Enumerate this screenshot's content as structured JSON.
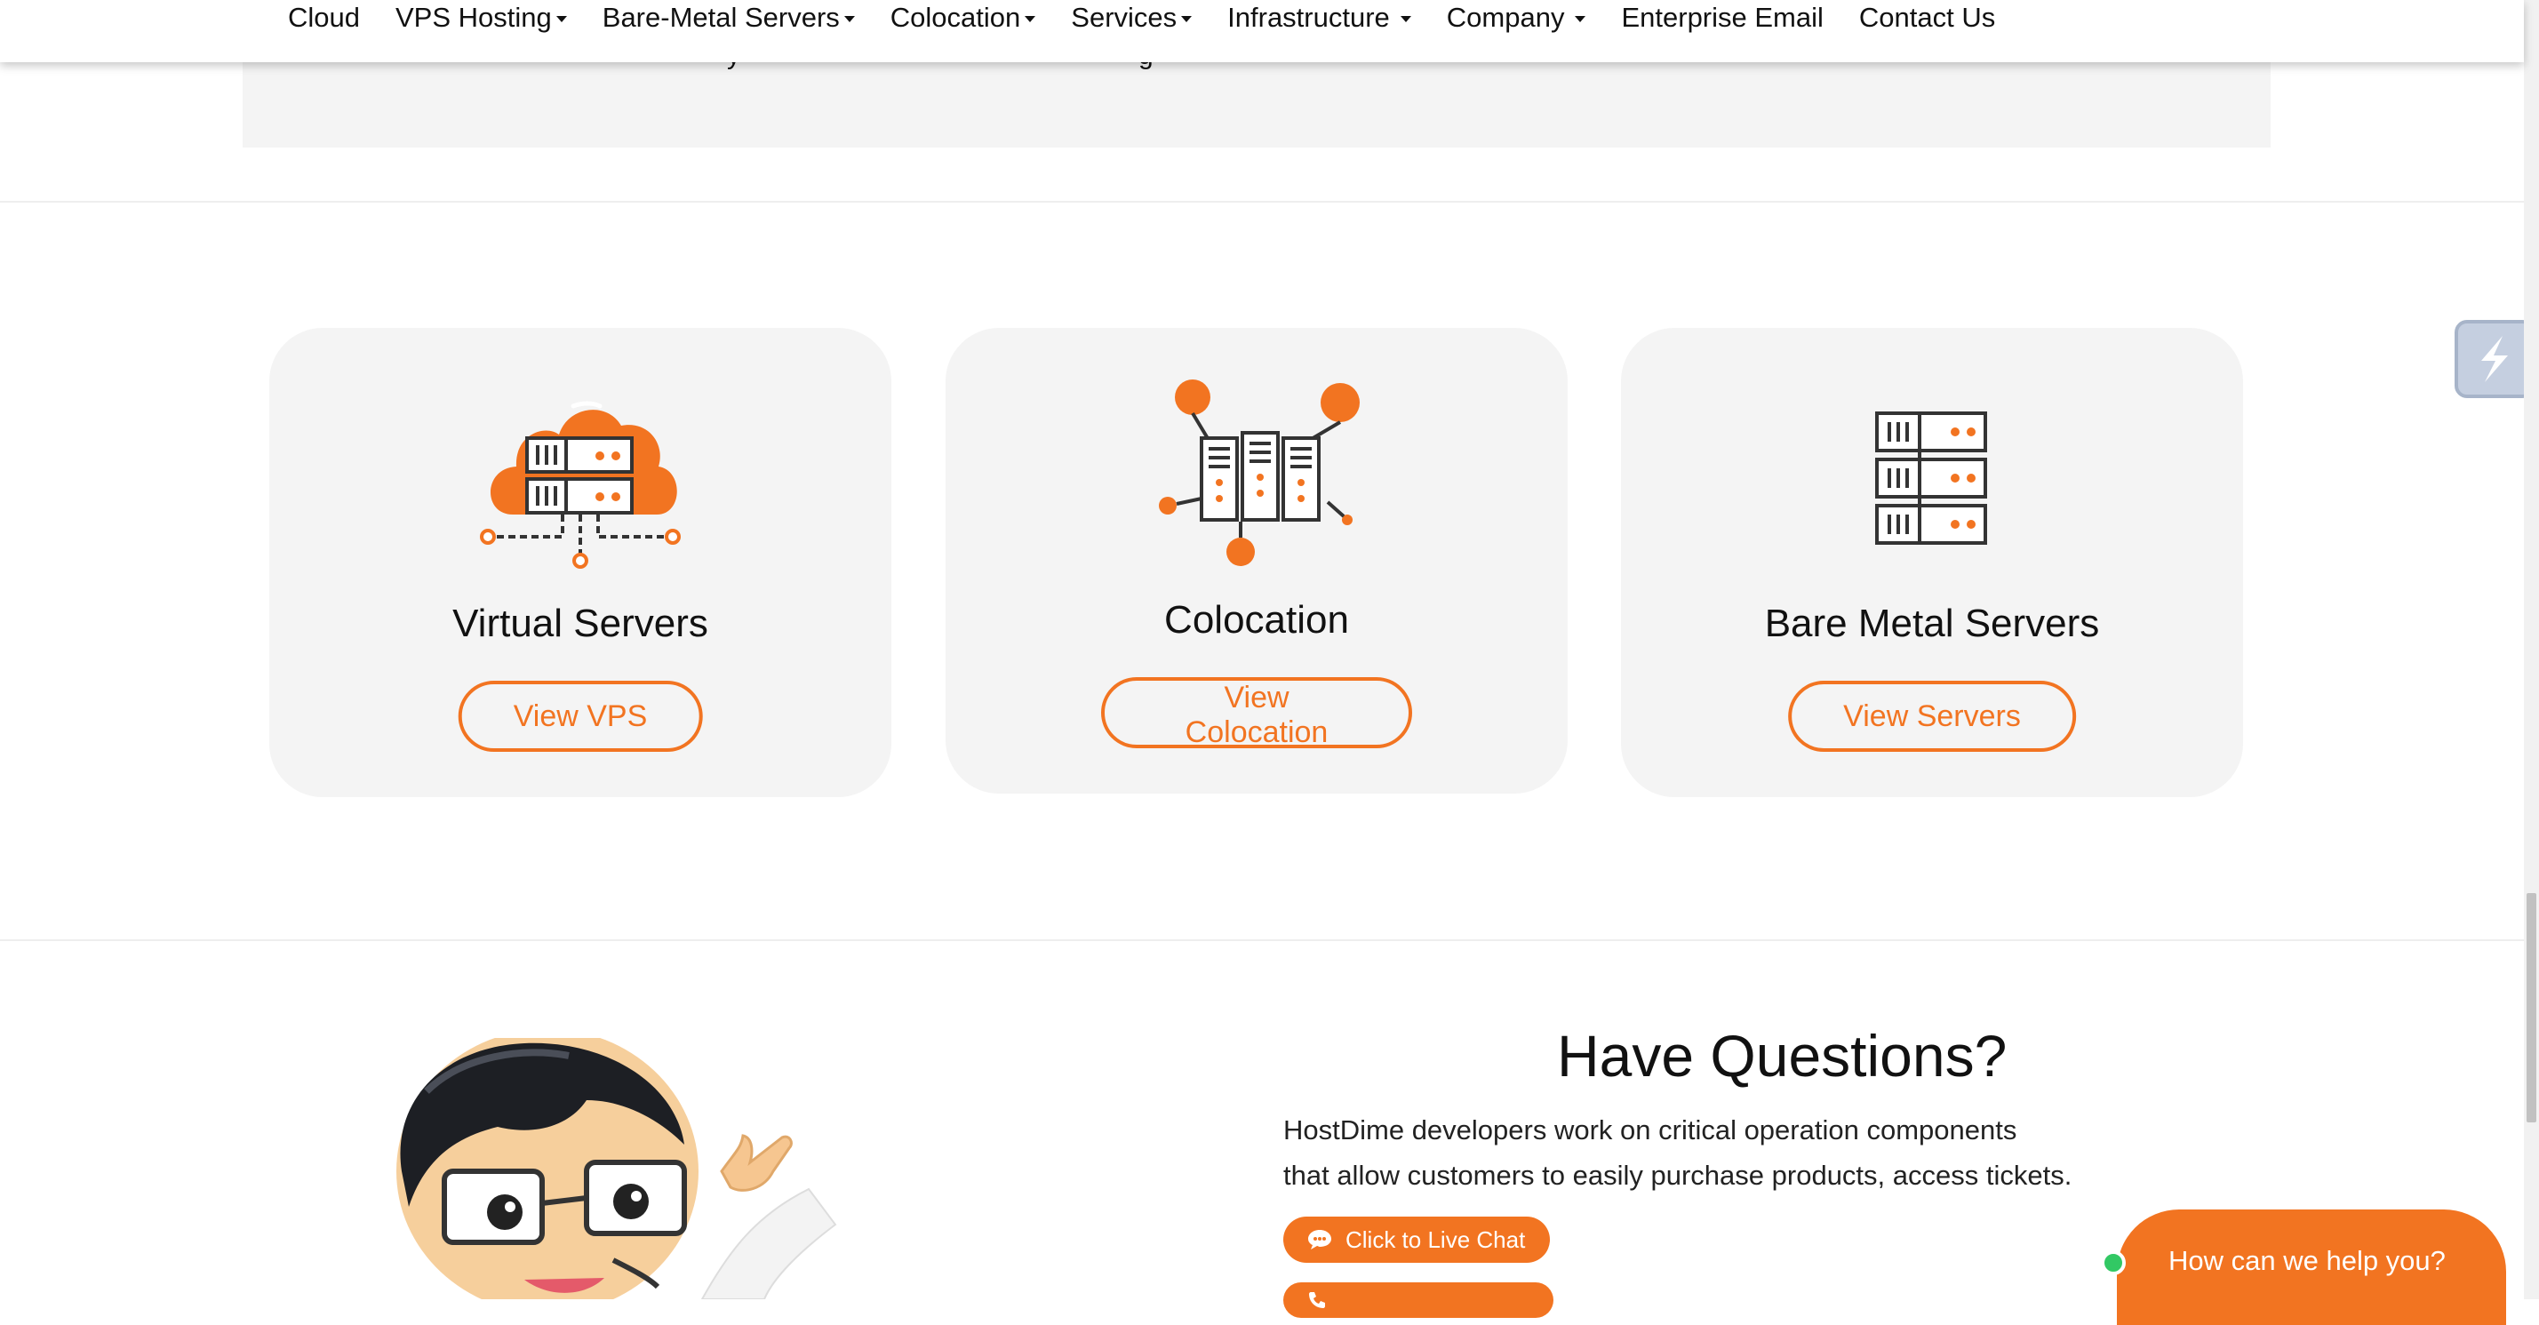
{
  "nav": {
    "items": [
      {
        "label": "Cloud",
        "caret": false
      },
      {
        "label": "VPS Hosting",
        "caret": true
      },
      {
        "label": "Bare-Metal Servers",
        "caret": true
      },
      {
        "label": "Colocation",
        "caret": true
      },
      {
        "label": "Services",
        "caret": true
      },
      {
        "label": "Infrastructure",
        "caret": true
      },
      {
        "label": "Company",
        "caret": true
      },
      {
        "label": "Enterprise Email",
        "caret": false
      },
      {
        "label": "Contact Us",
        "caret": false
      }
    ]
  },
  "cards": [
    {
      "title": "Virtual Servers",
      "button": "View VPS",
      "icon": "cloud-server-icon"
    },
    {
      "title": "Colocation",
      "button": "View Colocation",
      "icon": "colocation-racks-icon"
    },
    {
      "title": "Bare Metal Servers",
      "button": "View Servers",
      "icon": "server-stack-icon"
    }
  ],
  "questions": {
    "title": "Have Questions?",
    "line1": "HostDime developers work on critical operation components",
    "line2": "that allow customers to easily purchase products, access tickets.",
    "live_chat_label": "Click to Live Chat"
  },
  "chat_widget": {
    "label": "How can we help you?"
  },
  "colors": {
    "accent": "#f27421",
    "card_bg": "#f4f4f4",
    "online": "#32c864"
  }
}
